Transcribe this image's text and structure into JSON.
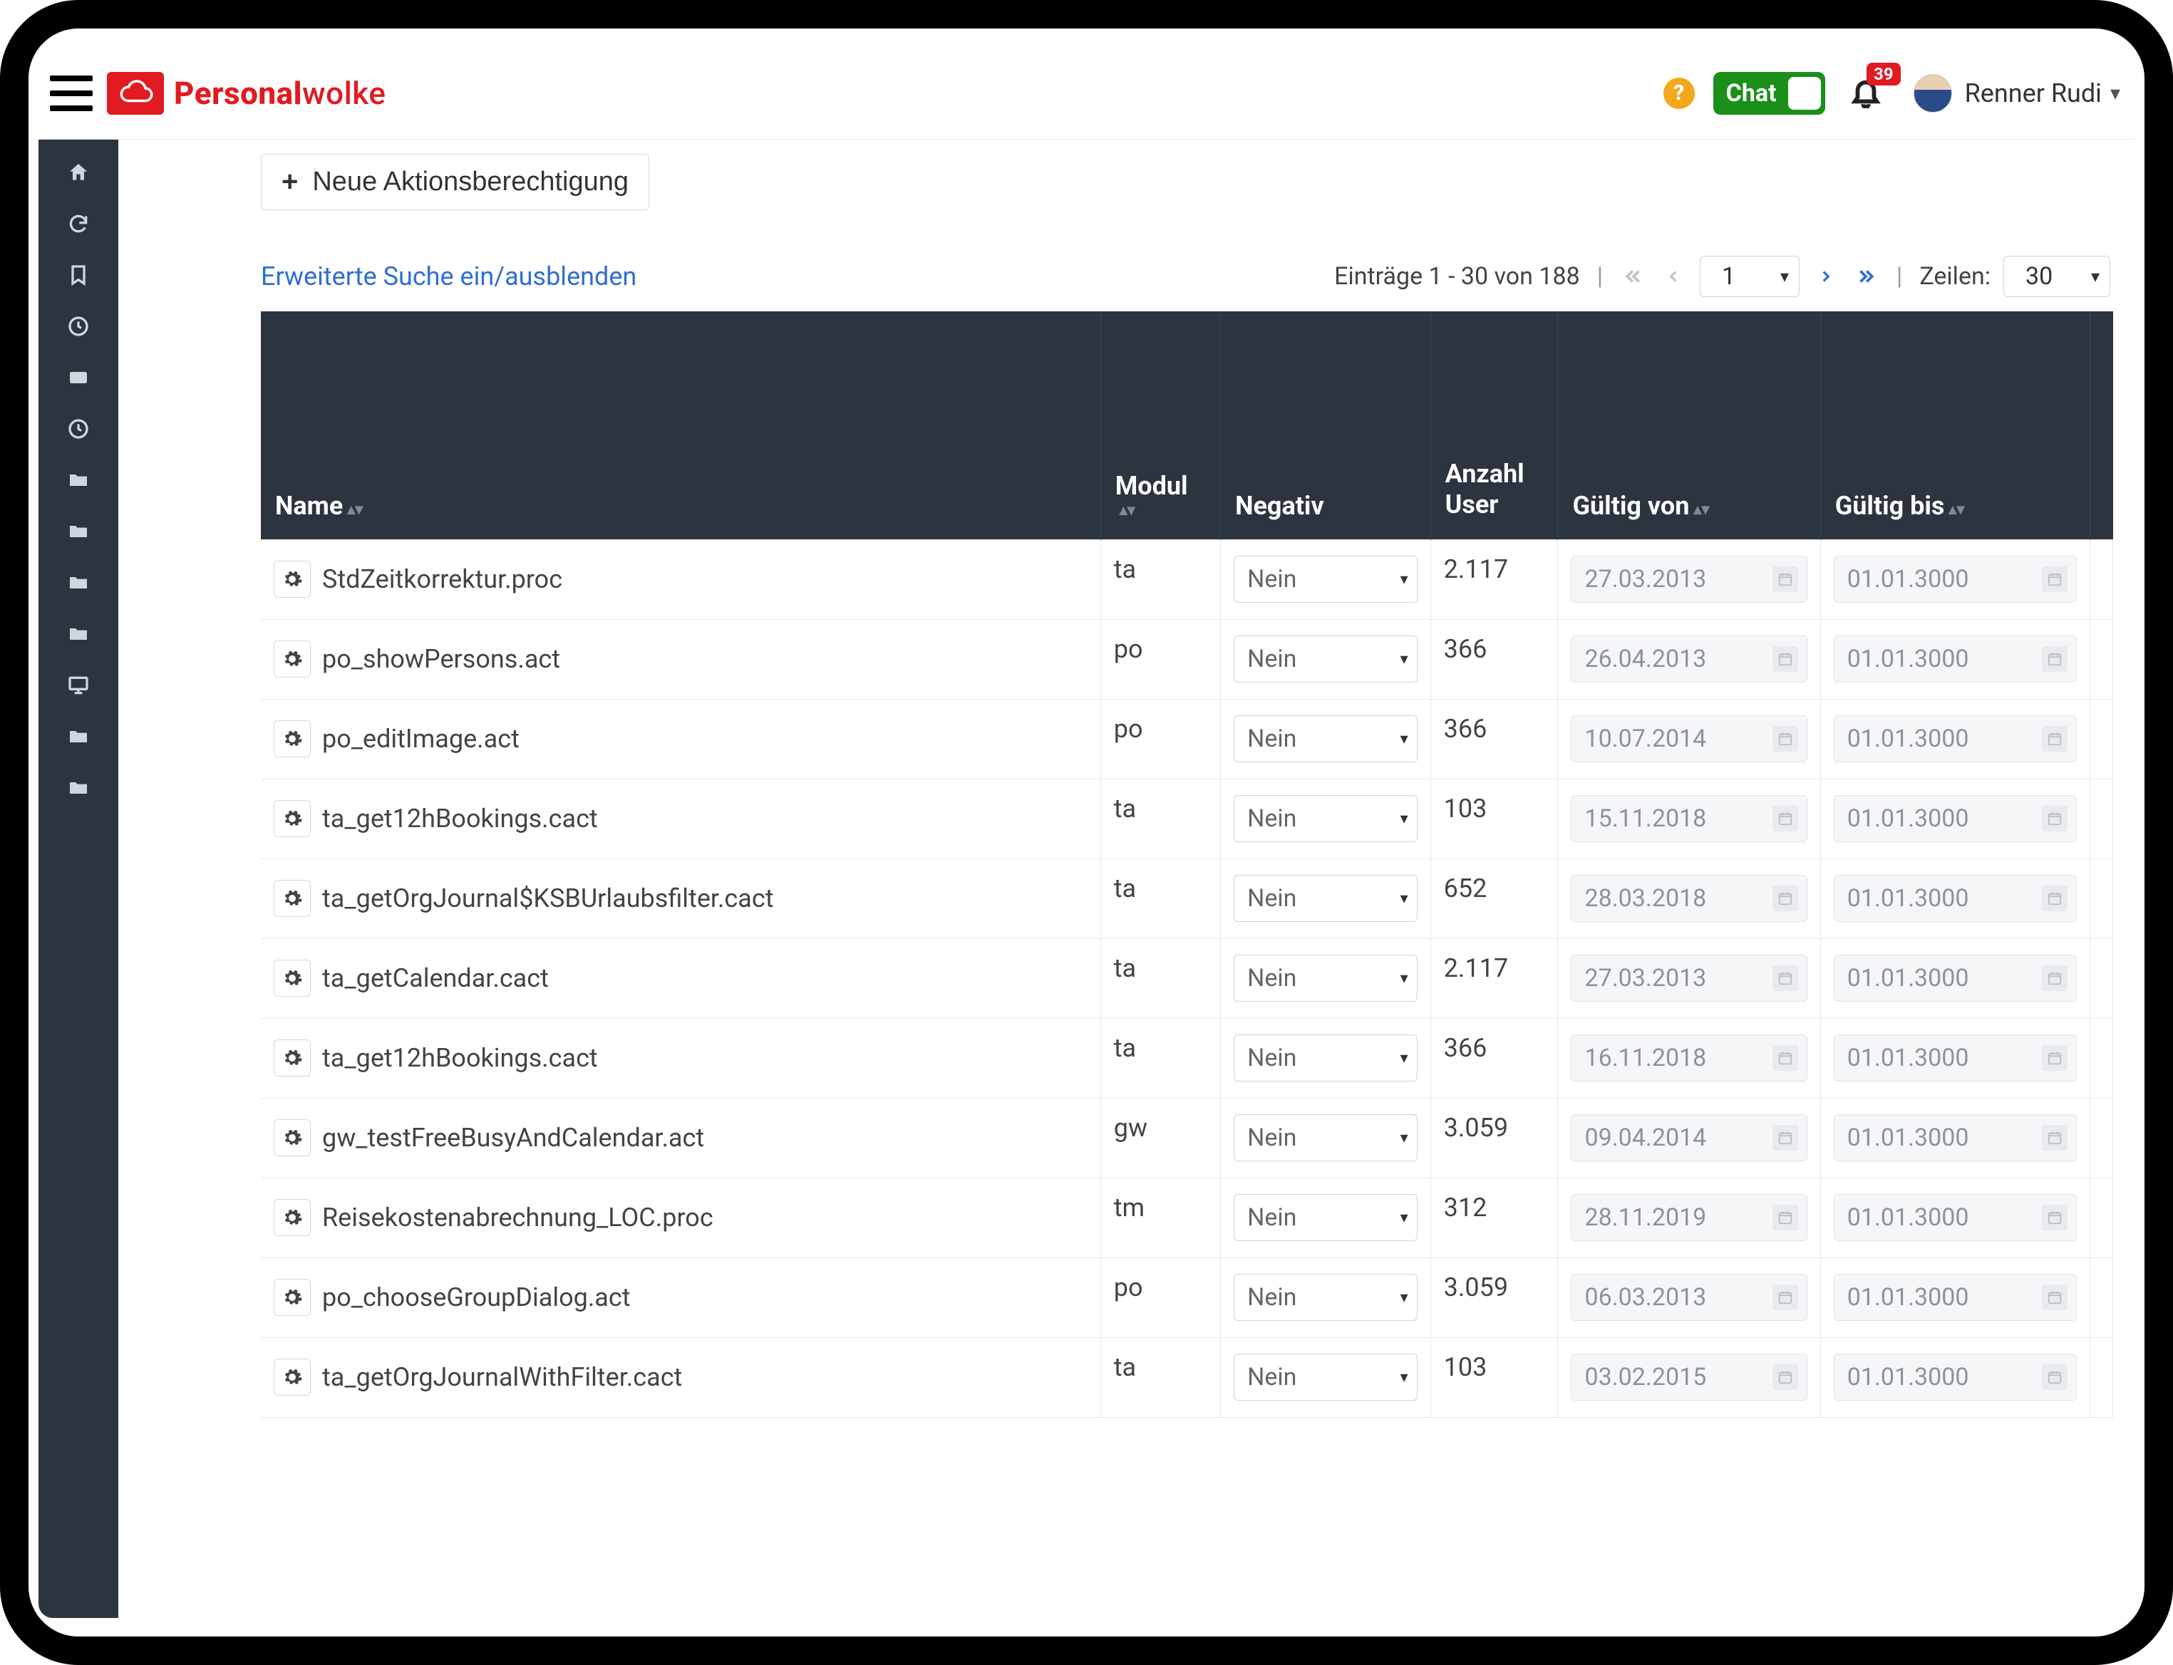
{
  "brand": {
    "name_bold": "Personal",
    "name_thin": "wolke"
  },
  "header": {
    "help_icon": "help-icon",
    "chat_label": "Chat",
    "notification_count": "39",
    "user_name": "Renner Rudi"
  },
  "toolbar": {
    "new_action_label": "Neue Aktionsberechtigung",
    "extended_search_label": "Erweiterte Suche ein/ausblenden"
  },
  "pager": {
    "entries_label": "Einträge 1 - 30 von 188",
    "current_page": "1",
    "rows_label": "Zeilen:",
    "rows_value": "30"
  },
  "columns": {
    "name": "Name",
    "module": "Modul",
    "negative": "Negativ",
    "users_line1": "Anzahl",
    "users_line2": "User",
    "valid_from": "Gültig von",
    "valid_to": "Gültig bis"
  },
  "negative_option": "Nein",
  "rows": [
    {
      "name": "StdZeitkorrektur.proc",
      "module": "ta",
      "users": "2.117",
      "from": "27.03.2013",
      "to": "01.01.3000"
    },
    {
      "name": "po_showPersons.act",
      "module": "po",
      "users": "366",
      "from": "26.04.2013",
      "to": "01.01.3000"
    },
    {
      "name": "po_editImage.act",
      "module": "po",
      "users": "366",
      "from": "10.07.2014",
      "to": "01.01.3000"
    },
    {
      "name": "ta_get12hBookings.cact",
      "module": "ta",
      "users": "103",
      "from": "15.11.2018",
      "to": "01.01.3000"
    },
    {
      "name": "ta_getOrgJournal$KSBUrlaubsfilter.cact",
      "module": "ta",
      "users": "652",
      "from": "28.03.2018",
      "to": "01.01.3000"
    },
    {
      "name": "ta_getCalendar.cact",
      "module": "ta",
      "users": "2.117",
      "from": "27.03.2013",
      "to": "01.01.3000"
    },
    {
      "name": "ta_get12hBookings.cact",
      "module": "ta",
      "users": "366",
      "from": "16.11.2018",
      "to": "01.01.3000"
    },
    {
      "name": "gw_testFreeBusyAndCalendar.act",
      "module": "gw",
      "users": "3.059",
      "from": "09.04.2014",
      "to": "01.01.3000"
    },
    {
      "name": "Reisekostenabrechnung_LOC.proc",
      "module": "tm",
      "users": "312",
      "from": "28.11.2019",
      "to": "01.01.3000"
    },
    {
      "name": "po_chooseGroupDialog.act",
      "module": "po",
      "users": "3.059",
      "from": "06.03.2013",
      "to": "01.01.3000"
    },
    {
      "name": "ta_getOrgJournalWithFilter.cact",
      "module": "ta",
      "users": "103",
      "from": "03.02.2015",
      "to": "01.01.3000"
    }
  ]
}
